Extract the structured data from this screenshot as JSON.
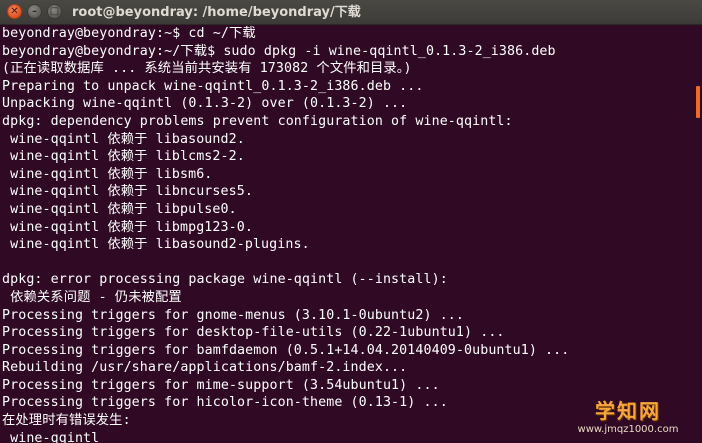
{
  "window": {
    "title": "root@beyondray: /home/beyondray/下载"
  },
  "icons": {
    "close": "close-icon",
    "minimize": "minimize-icon",
    "maximize": "maximize-icon"
  },
  "colors": {
    "terminal_background": "#300a24",
    "terminal_text": "#ffffff",
    "titlebar": "#3c3b37",
    "close_button": "#e0521f",
    "scrollbar_thumb": "#e86a2c"
  },
  "terminal": {
    "lines": [
      "beyondray@beyondray:~$ cd ~/下载",
      "beyondray@beyondray:~/下载$ sudo dpkg -i wine-qqintl_0.1.3-2_i386.deb",
      "(正在读取数据库 ... 系统当前共安装有 173082 个文件和目录。)",
      "Preparing to unpack wine-qqintl_0.1.3-2_i386.deb ...",
      "Unpacking wine-qqintl (0.1.3-2) over (0.1.3-2) ...",
      "dpkg: dependency problems prevent configuration of wine-qqintl:",
      " wine-qqintl 依赖于 libasound2.",
      " wine-qqintl 依赖于 liblcms2-2.",
      " wine-qqintl 依赖于 libsm6.",
      " wine-qqintl 依赖于 libncurses5.",
      " wine-qqintl 依赖于 libpulse0.",
      " wine-qqintl 依赖于 libmpg123-0.",
      " wine-qqintl 依赖于 libasound2-plugins.",
      "",
      "dpkg: error processing package wine-qqintl (--install):",
      " 依赖关系问题 - 仍未被配置",
      "Processing triggers for gnome-menus (3.10.1-0ubuntu2) ...",
      "Processing triggers for desktop-file-utils (0.22-1ubuntu1) ...",
      "Processing triggers for bamfdaemon (0.5.1+14.04.20140409-0ubuntu1) ...",
      "Rebuilding /usr/share/applications/bamf-2.index...",
      "Processing triggers for mime-support (3.54ubuntu1) ...",
      "Processing triggers for hicolor-icon-theme (0.13-1) ...",
      "在处理时有错误发生:",
      " wine-qqintl"
    ]
  },
  "watermark": {
    "text": "学知网",
    "url": "www.jmqz1000.com"
  }
}
